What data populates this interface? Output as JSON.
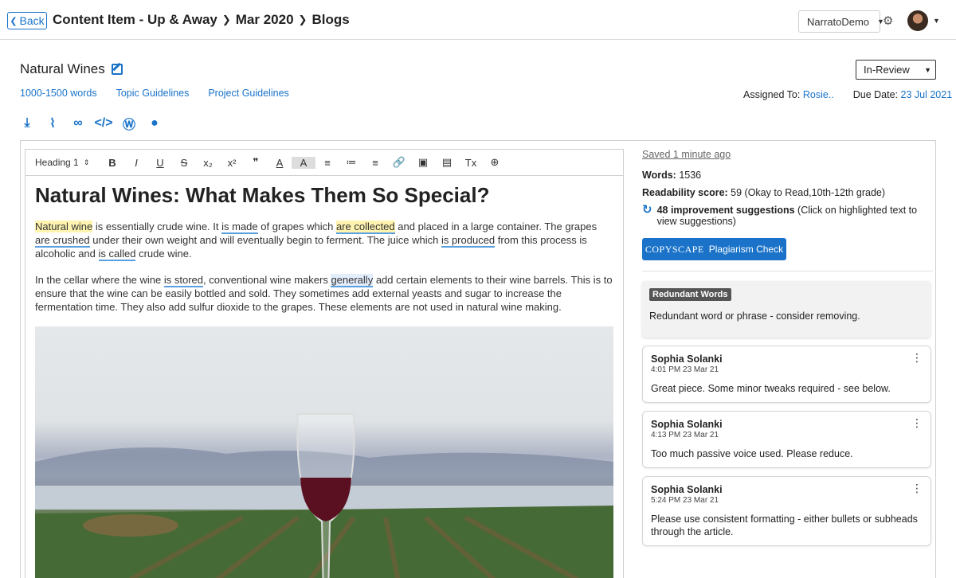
{
  "header": {
    "back_label": "Back",
    "breadcrumb": [
      "Content Item - Up & Away",
      "Mar 2020",
      "Blogs"
    ],
    "account": "NarratoDemo"
  },
  "doc": {
    "title": "Natural Wines",
    "status": "In-Review",
    "links": [
      "1000-1500 words",
      "Topic Guidelines",
      "Project Guidelines"
    ],
    "assigned_label": "Assigned To:",
    "assigned_value": "Rosie..",
    "due_label": "Due Date:",
    "due_value": "23 Jul 2021",
    "action_icons": [
      "download-icon",
      "attachment-icon",
      "link-icon",
      "code-icon",
      "wordpress-icon",
      "comment-icon"
    ]
  },
  "toolbar": {
    "heading": "Heading 1",
    "buttons": [
      "B",
      "I",
      "U",
      "S",
      "x₂",
      "x²",
      "❞",
      "A",
      "A",
      "≡",
      "≔",
      "≡",
      "🔗",
      "▣",
      "▤",
      "Tx",
      "⊕"
    ]
  },
  "article": {
    "heading": "Natural Wines: What Makes Them So Special?",
    "p1": [
      {
        "t": "Natural wine",
        "s": "hl-y"
      },
      {
        "t": " is essentially crude wine. It ",
        "s": ""
      },
      {
        "t": "is made",
        "s": "ul"
      },
      {
        "t": " of grapes which ",
        "s": ""
      },
      {
        "t": "are collected",
        "s": "hl-y ul"
      },
      {
        "t": " and placed in a large container. The grapes ",
        "s": ""
      },
      {
        "t": "are crushed",
        "s": "ul"
      },
      {
        "t": " under their own weight and will eventually begin to ferment. The juice which ",
        "s": ""
      },
      {
        "t": "is produced",
        "s": "ul"
      },
      {
        "t": " from this process is alcoholic and ",
        "s": ""
      },
      {
        "t": "is called",
        "s": "ul"
      },
      {
        "t": " crude wine.",
        "s": ""
      }
    ],
    "p2": [
      {
        "t": "In the cellar where the wine ",
        "s": ""
      },
      {
        "t": "is stored",
        "s": "ul"
      },
      {
        "t": ", conventional wine makers ",
        "s": ""
      },
      {
        "t": "generally",
        "s": "hl-b"
      },
      {
        "t": " add certain elements to their wine barrels. This is to ensure that the wine can be easily bottled and sold. They sometimes add external yeasts and sugar to increase the fermentation time. They also add sulfur dioxide to the grapes. These elements are not used in natural wine making.",
        "s": ""
      }
    ]
  },
  "sidebar": {
    "saved": "Saved 1 minute ago",
    "words_label": "Words:",
    "words_value": "1536",
    "readability_label": "Readability score:",
    "readability_value": "59 (Okay to Read,10th-12th grade)",
    "suggestions_bold": "48 improvement suggestions",
    "suggestions_rest": "(Click on highlighted text to view suggestions)",
    "copyscape_brand": "COPYSCAPE",
    "copyscape_label": "Plagiarism Check",
    "redundant_badge": "Redundant Words",
    "redundant_text": "Redundant word or phrase - consider removing.",
    "comments": [
      {
        "name": "Sophia Solanki",
        "time": "4:01 PM 23 Mar 21",
        "text": "Great piece. Some minor tweaks required - see below."
      },
      {
        "name": "Sophia Solanki",
        "time": "4:13 PM 23 Mar 21",
        "text": "Too much passive voice used. Please reduce."
      },
      {
        "name": "Sophia Solanki",
        "time": "5:24 PM 23 Mar 21",
        "text": "Please use consistent formatting - either bullets or subheads through the article."
      }
    ]
  }
}
